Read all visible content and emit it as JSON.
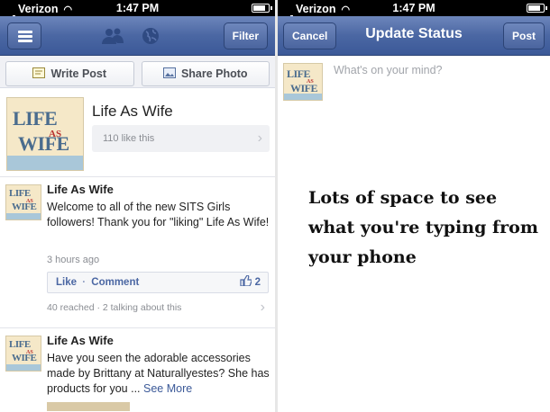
{
  "left": {
    "status_bar": {
      "carrier": "Verizon",
      "time": "1:47 PM"
    },
    "nav": {
      "filter_label": "Filter",
      "icons": [
        "menu-icon",
        "friends-icon",
        "globe-icon"
      ]
    },
    "actions": {
      "write_post": "Write Post",
      "share_photo": "Share Photo"
    },
    "page": {
      "name": "Life As Wife",
      "likes": "110 like this"
    },
    "logo": {
      "line1": "LIFE",
      "line2": "AS",
      "line3": "WIFE"
    },
    "posts": [
      {
        "author": "Life As Wife",
        "text": "Welcome to all of the new SITS Girls followers! Thank you for \"liking\" Life As Wife!",
        "time": "3 hours ago",
        "like_label": "Like",
        "separator": "·",
        "comment_label": "Comment",
        "like_count": "2",
        "reach": "40 reached · 2 talking about this"
      },
      {
        "author": "Life As Wife",
        "text": "Have you seen the adorable accessories made by Brittany at Naturallyestes? She has products for you ...",
        "see_more": "See More"
      }
    ]
  },
  "right": {
    "status_bar": {
      "carrier": "Verizon",
      "time": "1:47 PM"
    },
    "nav": {
      "cancel_label": "Cancel",
      "title": "Update Status",
      "post_label": "Post"
    },
    "compose": {
      "placeholder": "What's on your mind?"
    },
    "caption": "Lots of space to see what you're typing from your phone"
  },
  "colors": {
    "nav_blue": "#3b5998",
    "link_blue": "#4b67a3"
  }
}
